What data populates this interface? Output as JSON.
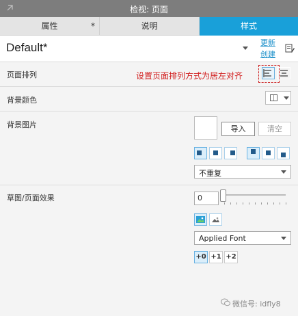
{
  "titlebar": {
    "title": "检视: 页面"
  },
  "tabs": [
    {
      "label": "属性",
      "modified": "*"
    },
    {
      "label": "说明"
    },
    {
      "label": "样式"
    }
  ],
  "style": {
    "name": "Default*",
    "update_link": "更新",
    "create_link": "创建"
  },
  "rows": {
    "page_alignment": {
      "label": "页面排列"
    },
    "bg_color": {
      "label": "背景颜色"
    },
    "bg_image": {
      "label": "背景图片",
      "import_label": "导入",
      "clear_label": "清空",
      "repeat_value": "不重复"
    },
    "sketch": {
      "label": "草图/页面效果",
      "value": "0",
      "font_value": "Applied Font",
      "font_sizes": [
        "+0",
        "+1",
        "+2"
      ]
    }
  },
  "annotation": "设置页面排列方式为居左对齐",
  "watermark": "微信号: idfly8",
  "colors": {
    "accent": "#19a0d9",
    "annotation": "#d22020"
  }
}
